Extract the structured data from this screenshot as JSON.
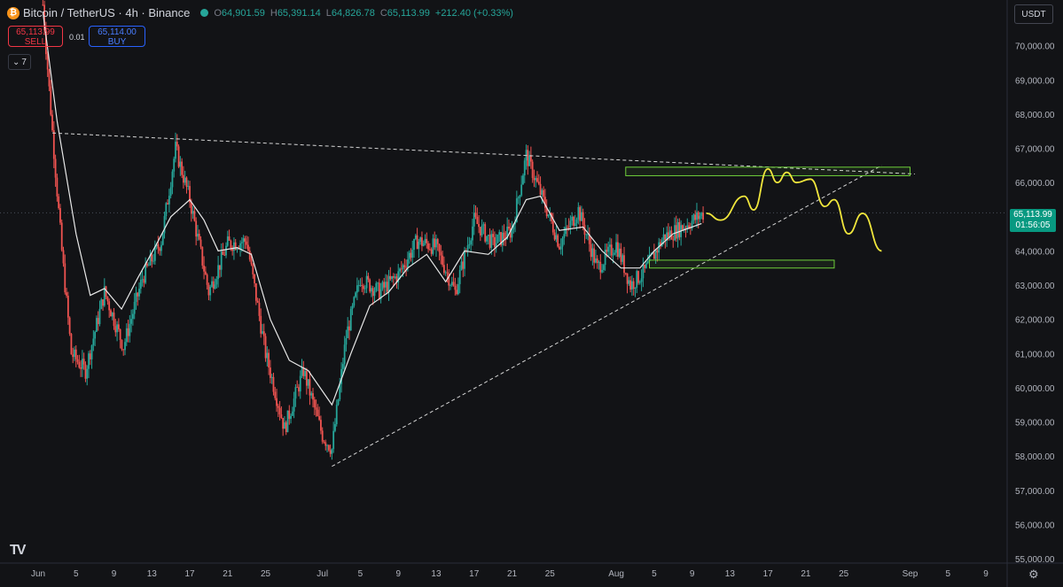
{
  "header": {
    "coin_glyph": "₿",
    "symbol": "Bitcoin / TetherUS · 4h · Binance",
    "open_key": "O",
    "open": "64,901.59",
    "high_key": "H",
    "high": "65,391.14",
    "low_key": "L",
    "low": "64,826.78",
    "close_key": "C",
    "close": "65,113.99",
    "change": "+212.40 (+0.33%)"
  },
  "trade": {
    "sell_price": "65,113.99",
    "sell_label": "SELL",
    "spread": "0.01",
    "buy_price": "65,114.00",
    "buy_label": "BUY",
    "indicators_count": "7",
    "indicators_chevron": "⌄"
  },
  "currency": "USDT",
  "price_tag": {
    "price": "65,113.99",
    "countdown": "01:56:05"
  },
  "tv_logo": "TV",
  "settings_icon": "⚙",
  "colors": {
    "background": "#121316",
    "up": "#26a69a",
    "down": "#ef5350",
    "ma": "#e8e8e8",
    "trendline": "#d6d6d6",
    "projection": "#f0e63c",
    "zone": "#6fcf3a",
    "axis_text": "#b2b5be"
  },
  "chart_data": {
    "type": "candlestick",
    "interval": "4h",
    "x_tick_labels": [
      "Jun",
      "5",
      "9",
      "13",
      "17",
      "21",
      "25",
      "Jul",
      "5",
      "9",
      "13",
      "17",
      "21",
      "25",
      "Aug",
      "5",
      "9",
      "13",
      "17",
      "21",
      "25",
      "Sep",
      "5",
      "9"
    ],
    "y_tick_labels": [
      "55,000.00",
      "56,000.00",
      "57,000.00",
      "58,000.00",
      "59,000.00",
      "60,000.00",
      "61,000.00",
      "62,000.00",
      "63,000.00",
      "64,000.00",
      "65,000.00",
      "66,000.00",
      "67,000.00",
      "68,000.00",
      "69,000.00",
      "70,000.00"
    ],
    "ylim": [
      55000,
      71250
    ],
    "xlim_days_since_jun1": [
      -1,
      100
    ],
    "last_price": 65113.99,
    "price_path": [
      {
        "day": 0.5,
        "price": 71200
      },
      {
        "day": 1.5,
        "price": 67500
      },
      {
        "day": 2.5,
        "price": 64000
      },
      {
        "day": 3.5,
        "price": 61000
      },
      {
        "day": 5,
        "price": 60500
      },
      {
        "day": 7,
        "price": 62800
      },
      {
        "day": 9,
        "price": 61200
      },
      {
        "day": 11,
        "price": 63200
      },
      {
        "day": 13,
        "price": 64300
      },
      {
        "day": 14.5,
        "price": 67000
      },
      {
        "day": 16,
        "price": 65500
      },
      {
        "day": 18,
        "price": 62800
      },
      {
        "day": 20,
        "price": 64200
      },
      {
        "day": 22,
        "price": 64300
      },
      {
        "day": 24,
        "price": 61000
      },
      {
        "day": 26,
        "price": 58800
      },
      {
        "day": 28,
        "price": 60500
      },
      {
        "day": 30,
        "price": 58600
      },
      {
        "day": 31,
        "price": 58200
      },
      {
        "day": 32.5,
        "price": 61500
      },
      {
        "day": 34,
        "price": 63200
      },
      {
        "day": 36,
        "price": 62800
      },
      {
        "day": 38,
        "price": 63300
      },
      {
        "day": 40,
        "price": 64300
      },
      {
        "day": 42,
        "price": 64100
      },
      {
        "day": 44,
        "price": 62800
      },
      {
        "day": 46,
        "price": 64900
      },
      {
        "day": 48,
        "price": 64200
      },
      {
        "day": 50,
        "price": 64600
      },
      {
        "day": 51.5,
        "price": 66800
      },
      {
        "day": 53,
        "price": 65700
      },
      {
        "day": 55,
        "price": 64200
      },
      {
        "day": 57,
        "price": 65200
      },
      {
        "day": 59,
        "price": 63500
      },
      {
        "day": 61,
        "price": 64200
      },
      {
        "day": 62.5,
        "price": 63000
      },
      {
        "day": 64,
        "price": 63400
      },
      {
        "day": 66,
        "price": 64400
      },
      {
        "day": 68,
        "price": 64700
      },
      {
        "day": 70.3,
        "price": 65113.99
      }
    ],
    "moving_average": [
      {
        "day": 0.5,
        "price": 71000
      },
      {
        "day": 2,
        "price": 67800
      },
      {
        "day": 4,
        "price": 64500
      },
      {
        "day": 5.5,
        "price": 62700
      },
      {
        "day": 7,
        "price": 62900
      },
      {
        "day": 8.8,
        "price": 62300
      },
      {
        "day": 10.5,
        "price": 63200
      },
      {
        "day": 12.5,
        "price": 64200
      },
      {
        "day": 14,
        "price": 65000
      },
      {
        "day": 16,
        "price": 65500
      },
      {
        "day": 17.5,
        "price": 64900
      },
      {
        "day": 19,
        "price": 64000
      },
      {
        "day": 21,
        "price": 64100
      },
      {
        "day": 22.5,
        "price": 63900
      },
      {
        "day": 24.5,
        "price": 62000
      },
      {
        "day": 26.5,
        "price": 60800
      },
      {
        "day": 28.5,
        "price": 60500
      },
      {
        "day": 31,
        "price": 59500
      },
      {
        "day": 33,
        "price": 61000
      },
      {
        "day": 35,
        "price": 62400
      },
      {
        "day": 37,
        "price": 62800
      },
      {
        "day": 39,
        "price": 63500
      },
      {
        "day": 41,
        "price": 63900
      },
      {
        "day": 43,
        "price": 63100
      },
      {
        "day": 45,
        "price": 64000
      },
      {
        "day": 47.5,
        "price": 63900
      },
      {
        "day": 49.5,
        "price": 64400
      },
      {
        "day": 51.5,
        "price": 65500
      },
      {
        "day": 53,
        "price": 65600
      },
      {
        "day": 55,
        "price": 64600
      },
      {
        "day": 57.5,
        "price": 64700
      },
      {
        "day": 59.5,
        "price": 64000
      },
      {
        "day": 61.5,
        "price": 63500
      },
      {
        "day": 63.5,
        "price": 63500
      },
      {
        "day": 65,
        "price": 64000
      },
      {
        "day": 67,
        "price": 64500
      },
      {
        "day": 70,
        "price": 64800
      }
    ],
    "trendlines": [
      {
        "style": "dashed",
        "from": {
          "day": 1.5,
          "price": 67450
        },
        "to": {
          "day": 92.5,
          "price": 66250
        }
      },
      {
        "style": "dashed",
        "from": {
          "day": 31,
          "price": 57700
        },
        "to": {
          "day": 89,
          "price": 66500
        }
      }
    ],
    "zones": [
      {
        "name": "resistance",
        "x": [
          62,
          92
        ],
        "y": [
          66200,
          66450
        ]
      },
      {
        "name": "support",
        "x": [
          64.5,
          84
        ],
        "y": [
          63500,
          63730
        ]
      }
    ],
    "projection": [
      {
        "day": 70.5,
        "price": 65100
      },
      {
        "day": 72,
        "price": 64900
      },
      {
        "day": 74.5,
        "price": 65600
      },
      {
        "day": 75.5,
        "price": 65200
      },
      {
        "day": 77,
        "price": 66400
      },
      {
        "day": 78,
        "price": 66000
      },
      {
        "day": 79,
        "price": 66300
      },
      {
        "day": 80,
        "price": 66000
      },
      {
        "day": 81.5,
        "price": 66100
      },
      {
        "day": 83,
        "price": 65300
      },
      {
        "day": 84,
        "price": 65500
      },
      {
        "day": 85.5,
        "price": 64500
      },
      {
        "day": 87,
        "price": 65100
      },
      {
        "day": 89,
        "price": 64000
      }
    ]
  }
}
